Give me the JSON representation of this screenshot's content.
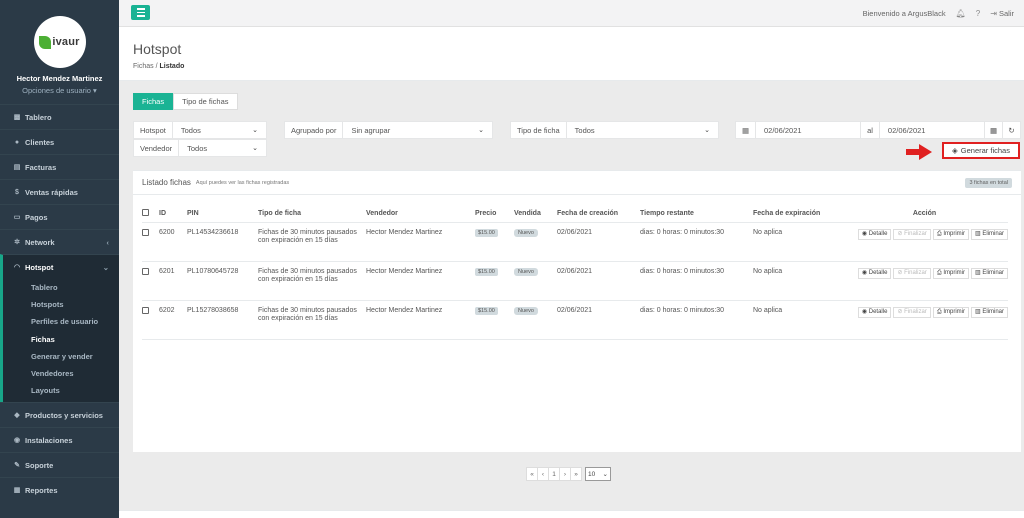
{
  "brand": {
    "logo_text": "ivaur"
  },
  "user": {
    "name": "Hector Mendez Martinez",
    "options": "Opciones de usuario ▾"
  },
  "sidebar": {
    "items": [
      {
        "label": "Tablero",
        "icon": "dashboard-icon"
      },
      {
        "label": "Clientes",
        "icon": "users-icon"
      },
      {
        "label": "Facturas",
        "icon": "invoice-icon"
      },
      {
        "label": "Ventas rápidas",
        "icon": "dollar-icon"
      },
      {
        "label": "Pagos",
        "icon": "payment-icon"
      },
      {
        "label": "Network",
        "icon": "network-icon"
      },
      {
        "label": "Hotspot",
        "icon": "wifi-icon"
      }
    ],
    "hotspot_sub": [
      "Tablero",
      "Hotspots",
      "Perfiles de usuario",
      "Fichas",
      "Generar y vender",
      "Vendedores",
      "Layouts"
    ],
    "bottom_items": [
      {
        "label": "Productos y servicios",
        "icon": "tag-icon"
      },
      {
        "label": "Instalaciones",
        "icon": "install-icon"
      },
      {
        "label": "Soporte",
        "icon": "wrench-icon"
      },
      {
        "label": "Reportes",
        "icon": "report-icon"
      }
    ]
  },
  "topbar": {
    "welcome": "Bienvenido a ArgusBlack",
    "logout": "Salir"
  },
  "header": {
    "title": "Hotspot",
    "crumb_parent": "Fichas",
    "crumb_sep": "/",
    "crumb_current": "Listado"
  },
  "tabs": [
    "Fichas",
    "Tipo de fichas"
  ],
  "filters": {
    "hotspot_label": "Hotspot",
    "hotspot_value": "Todos",
    "agrupado_label": "Agrupado por",
    "agrupado_value": "Sin agrupar",
    "tipo_label": "Tipo de ficha",
    "tipo_value": "Todos",
    "date_from": "02/06/2021",
    "date_sep": "al",
    "date_to": "02/06/2021",
    "vendedor_label": "Vendedor",
    "vendedor_value": "Todos"
  },
  "generate_button": "Generar fichas",
  "panel": {
    "title": "Listado fichas",
    "subtitle": "Aquí puedes ver las fichas registradas",
    "count_badge": "3 fichas en total"
  },
  "table": {
    "headers": [
      "ID",
      "PIN",
      "Tipo de ficha",
      "Vendedor",
      "Precio",
      "Vendida",
      "Fecha de creación",
      "Tiempo restante",
      "Fecha de expiración",
      "Acción"
    ],
    "rows": [
      {
        "id": "6200",
        "pin": "PL14534236618",
        "tipo": "Fichas de 30 minutos pausados con expiración en 15 días",
        "vendedor": "Hector Mendez Martinez",
        "precio": "$15.00",
        "vendida": "Nuevo",
        "fecha_creacion": "02/06/2021",
        "tiempo": "dias: 0 horas: 0 minutos:30",
        "expiracion": "No aplica"
      },
      {
        "id": "6201",
        "pin": "PL10780645728",
        "tipo": "Fichas de 30 minutos pausados con expiración en 15 días",
        "vendedor": "Hector Mendez Martinez",
        "precio": "$15.00",
        "vendida": "Nuevo",
        "fecha_creacion": "02/06/2021",
        "tiempo": "dias: 0 horas: 0 minutos:30",
        "expiracion": "No aplica"
      },
      {
        "id": "6202",
        "pin": "PL15278038658",
        "tipo": "Fichas de 30 minutos pausados con expiración en 15 días",
        "vendedor": "Hector Mendez Martinez",
        "precio": "$15.00",
        "vendida": "Nuevo",
        "fecha_creacion": "02/06/2021",
        "tiempo": "dias: 0 horas: 0 minutos:30",
        "expiracion": "No aplica"
      }
    ],
    "action_labels": {
      "detalle": "Detalle",
      "finalizar": "Finalizar",
      "imprimir": "Imprimir",
      "eliminar": "Eliminar"
    }
  },
  "pagination": {
    "first": "«",
    "prev": "‹",
    "page": "1",
    "next": "›",
    "last": "»",
    "page_size": "10"
  },
  "colors": {
    "accent": "#1ab394",
    "sidebar": "#2b3a47",
    "highlight": "#e02020"
  }
}
